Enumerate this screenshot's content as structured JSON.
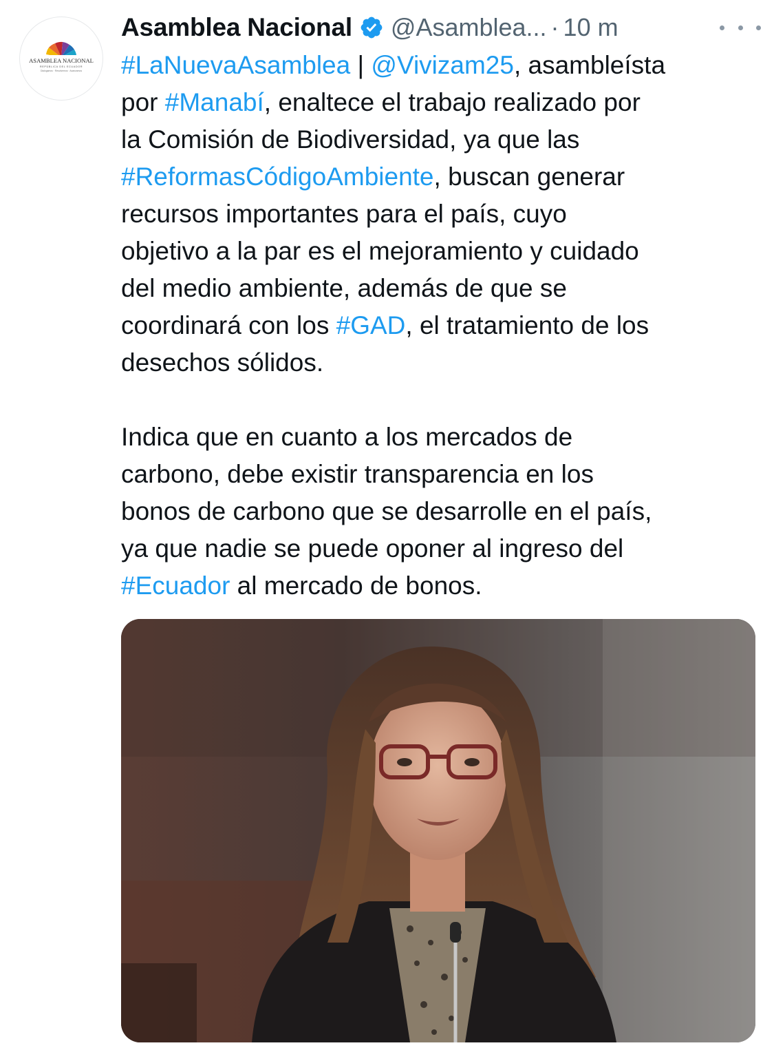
{
  "tweet": {
    "author": {
      "display_name": "Asamblea Nacional",
      "handle": "@Asamblea...",
      "verified": true,
      "avatar_icon": "asamblea-nacional-logo",
      "avatar_logo_text": "ASAMBLEA NACIONAL",
      "avatar_logo_subtext": "REPÚBLICA DEL ECUADOR",
      "avatar_logo_tagline": "Dialogamos · Resolvemos · Avanzamos"
    },
    "separator": "·",
    "time": "10 m",
    "more_icon": "more-horizontal-icon",
    "body": {
      "p1": {
        "l1": {
          "a": "#LaNuevaAsamblea",
          "b": " | ",
          "c": "@Vivizam25",
          "d": ", asambleísta"
        },
        "l2": {
          "a": "por ",
          "b": "#Manabí",
          "c": ", enaltece el trabajo realizado por"
        },
        "l3": "la Comisión de Biodiversidad, ya que las",
        "l4": {
          "a": "#ReformasCódigoAmbiente",
          "b": ", buscan generar"
        },
        "l5": "recursos importantes para el país, cuyo",
        "l6": "objetivo a la par es el mejoramiento y cuidado",
        "l7": "del medio ambiente, además de que se",
        "l8": {
          "a": "coordinará con los ",
          "b": "#GAD",
          "c": ", el tratamiento de los"
        },
        "l9": "desechos sólidos."
      },
      "p2": {
        "l1": "Indica que en cuanto a los mercados de",
        "l2": "carbono, debe existir transparencia en los",
        "l3": "bonos de carbono que se desarrolle en el país,",
        "l4": "ya que nadie se puede oponer al ingreso del",
        "l5": {
          "a": "#Ecuador",
          "b": " al mercado de bonos."
        }
      }
    },
    "media": {
      "kind": "photo",
      "subject": "woman-speaking-at-microphone"
    }
  },
  "colors": {
    "text": "#0f1419",
    "secondary": "#536471",
    "link": "#1d9bf0",
    "verified": "#1d9bf0"
  }
}
